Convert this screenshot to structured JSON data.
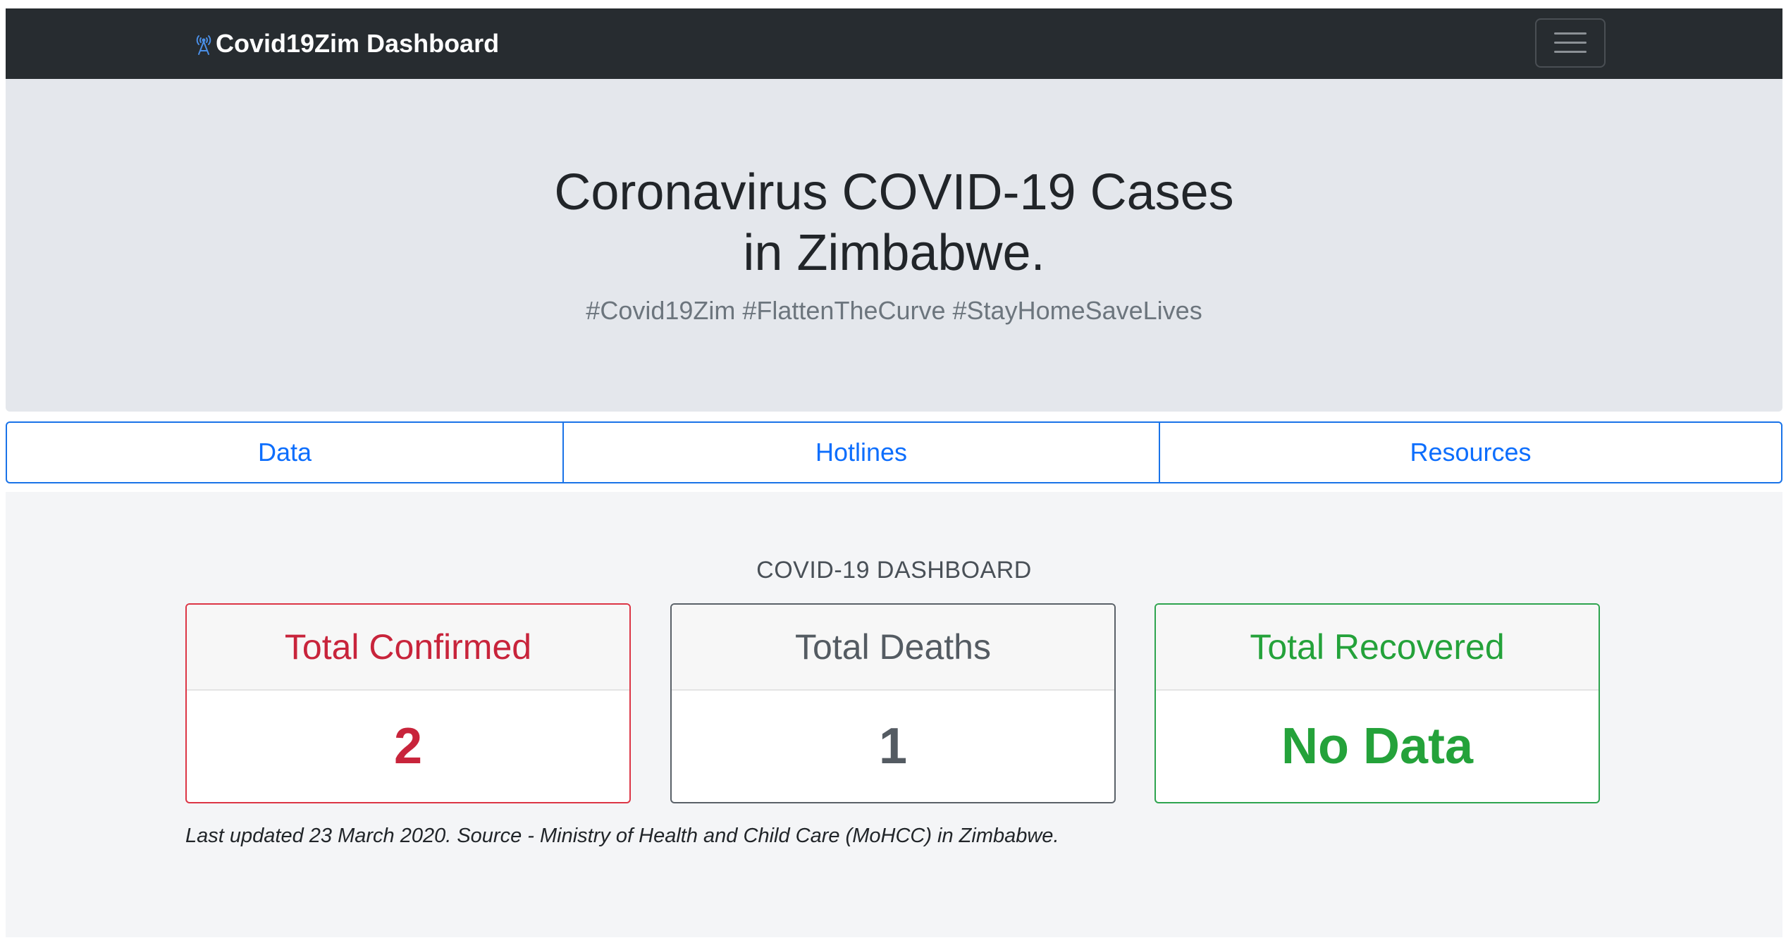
{
  "navbar": {
    "brand": "Covid19Zim Dashboard",
    "brand_icon": "broadcast-tower-icon",
    "toggler_icon": "hamburger-menu-icon",
    "bg_color": "#272c30"
  },
  "hero": {
    "title": "Coronavirus COVID-19 Cases in Zimbabwe.",
    "subtitle": "#Covid19Zim #FlattenTheCurve #StayHomeSaveLives"
  },
  "tabs": [
    {
      "label": "Data"
    },
    {
      "label": "Hotlines"
    },
    {
      "label": "Resources"
    }
  ],
  "dashboard": {
    "title": "COVID-19 DASHBOARD",
    "cards": [
      {
        "label": "Total Confirmed",
        "value": "2",
        "color": "#c8243b"
      },
      {
        "label": "Total Deaths",
        "value": "1",
        "color": "#545b62"
      },
      {
        "label": "Total Recovered",
        "value": "No Data",
        "color": "#24a23a"
      }
    ],
    "updated": "Last updated 23 March 2020. Source - Ministry of Health and Child Care (MoHCC) in Zimbabwe."
  },
  "colors": {
    "accent": "#0d6efd",
    "hero_bg": "#e4e7ec",
    "section_bg": "#f4f5f7"
  }
}
